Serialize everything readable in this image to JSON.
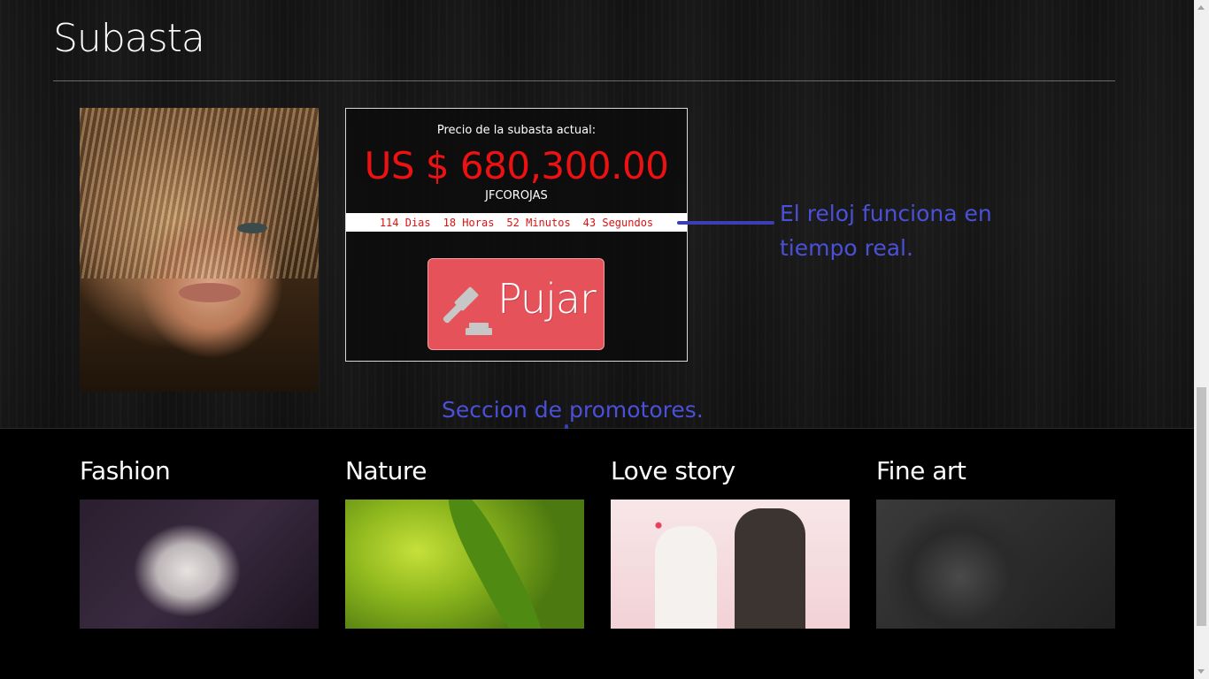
{
  "auction": {
    "title": "Subasta",
    "price_label": "Precio de la subasta actual:",
    "price_value": "US $ 680,300.00",
    "bidder": "JFCOROJAS",
    "countdown": {
      "days": "114 Dias",
      "hours": "18 Horas",
      "minutes": "52 Minutos",
      "seconds": "43 Segundos"
    },
    "bid_button_label": "Pujar",
    "bid_button_icon": "gavel-icon"
  },
  "annotations": {
    "clock": "El reloj funciona en tiempo real.",
    "promoters": "Seccion de promotores."
  },
  "promoters": [
    {
      "title": "Fashion"
    },
    {
      "title": "Nature"
    },
    {
      "title": "Love story"
    },
    {
      "title": "Fine art"
    }
  ],
  "colors": {
    "price": "#ee1111",
    "bid_button": "#e5525a",
    "annotation": "#4a50d8"
  }
}
